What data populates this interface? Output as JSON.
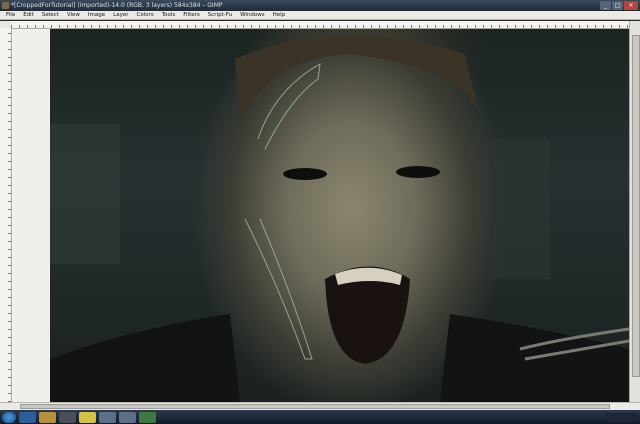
{
  "window": {
    "title": "*[CroppedForTutorial] (imported)-14.0 (RGB, 3 layers) 584x384 – GIMP",
    "controls": [
      "_",
      "□",
      "✕"
    ]
  },
  "menu": [
    "File",
    "Edit",
    "Select",
    "View",
    "Image",
    "Layer",
    "Colors",
    "Tools",
    "Filters",
    "Script-Fu",
    "Windows",
    "Help"
  ],
  "taskbar": {
    "icons": [
      "start-orb-icon",
      "ie-icon",
      "folder-icon",
      "media-icon",
      "notes-icon",
      "gimp-icon",
      "image-icon",
      "gimp-toolbox-icon"
    ]
  }
}
